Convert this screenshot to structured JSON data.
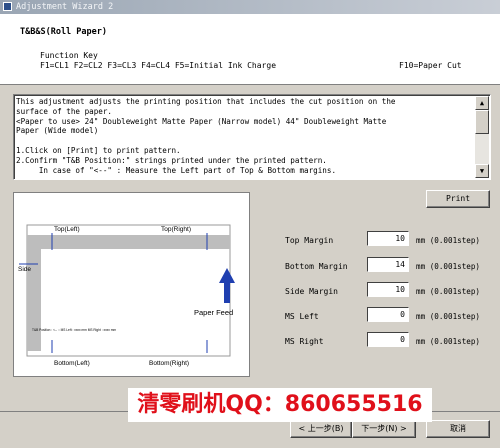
{
  "window": {
    "title": "Adjustment Wizard 2"
  },
  "header": {
    "title": "T&B&S(Roll Paper)",
    "function_key_label": "Function Key",
    "function_keys": "F1=CL1  F2=CL2  F3=CL3  F4=CL4  F5=Initial Ink Charge",
    "f10": "F10=Paper Cut"
  },
  "description": "This adjustment adjusts the printing position that includes the cut position on the\nsurface of the paper.\n<Paper to use> 24\" Doubleweight Matte Paper (Narrow model) 44\" Doubleweight Matte\nPaper (Wide model)\n\n1.Click on [Print] to print pattern.\n2.Confirm \"T&B Position:\" strings printed under the printed pattern.\n     In case of \"<--\" : Measure the Left part of Top & Bottom margins.",
  "buttons": {
    "print": "Print",
    "back": "< 上一步(B)",
    "next": "下一步(N) >",
    "cancel": "取消"
  },
  "diagram": {
    "top_left": "Top(Left)",
    "top_right": "Top(Right)",
    "side": "Side",
    "paper_feed": "Paper Feed",
    "bottom_left": "Bottom(Left)",
    "bottom_right": "Bottom(Right)",
    "pattern_text": "T&B Position : <-- ::    MS Left : xxxx mm    MS Right : xxxx mm"
  },
  "fields": [
    {
      "label": "Top Margin",
      "value": "10",
      "unit": "mm (0.001step)"
    },
    {
      "label": "Bottom Margin",
      "value": "14",
      "unit": "mm (0.001step)"
    },
    {
      "label": "Side Margin",
      "value": "10",
      "unit": "mm (0.001step)"
    },
    {
      "label": "MS Left",
      "value": "0",
      "unit": "mm (0.001step)"
    },
    {
      "label": "MS Right",
      "value": "0",
      "unit": "mm (0.001step)"
    }
  ],
  "watermark": "清零刷机QQ：860655516",
  "colors": {
    "arrow": "#1f3fb0",
    "watermark": "#e0101a",
    "gray_bar": "#bdbdbd"
  }
}
